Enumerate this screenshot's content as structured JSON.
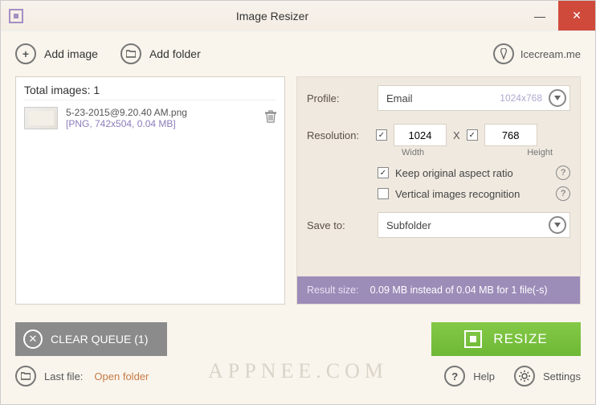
{
  "window": {
    "title": "Image Resizer",
    "brand": "Icecream.me"
  },
  "toolbar": {
    "add_image": "Add image",
    "add_folder": "Add folder"
  },
  "list": {
    "total_label": "Total images: 1",
    "items": [
      {
        "name": "5-23-2015@9.20.40 AM.png",
        "meta": "[PNG, 742x504, 0.04 MB]"
      }
    ]
  },
  "panel": {
    "profile_label": "Profile:",
    "profile_value": "Email",
    "profile_dim": "1024x768",
    "resolution_label": "Resolution:",
    "width_value": "1024",
    "height_value": "768",
    "width_label": "Width",
    "height_label": "Height",
    "x": "X",
    "keep_ratio": "Keep original aspect ratio",
    "vertical_rec": "Vertical images recognition",
    "save_to_label": "Save to:",
    "save_to_value": "Subfolder",
    "keep_checked": "✓",
    "width_checked": "✓",
    "height_checked": "✓"
  },
  "result": {
    "label": "Result size:",
    "text": "0.09 MB instead of 0.04 MB for 1 file(-s)"
  },
  "buttons": {
    "clear": "CLEAR QUEUE (1)",
    "resize": "RESIZE"
  },
  "status": {
    "last_file": "Last file:",
    "open_folder": "Open folder",
    "help": "Help",
    "settings": "Settings"
  },
  "watermark": "APPNEE.COM"
}
